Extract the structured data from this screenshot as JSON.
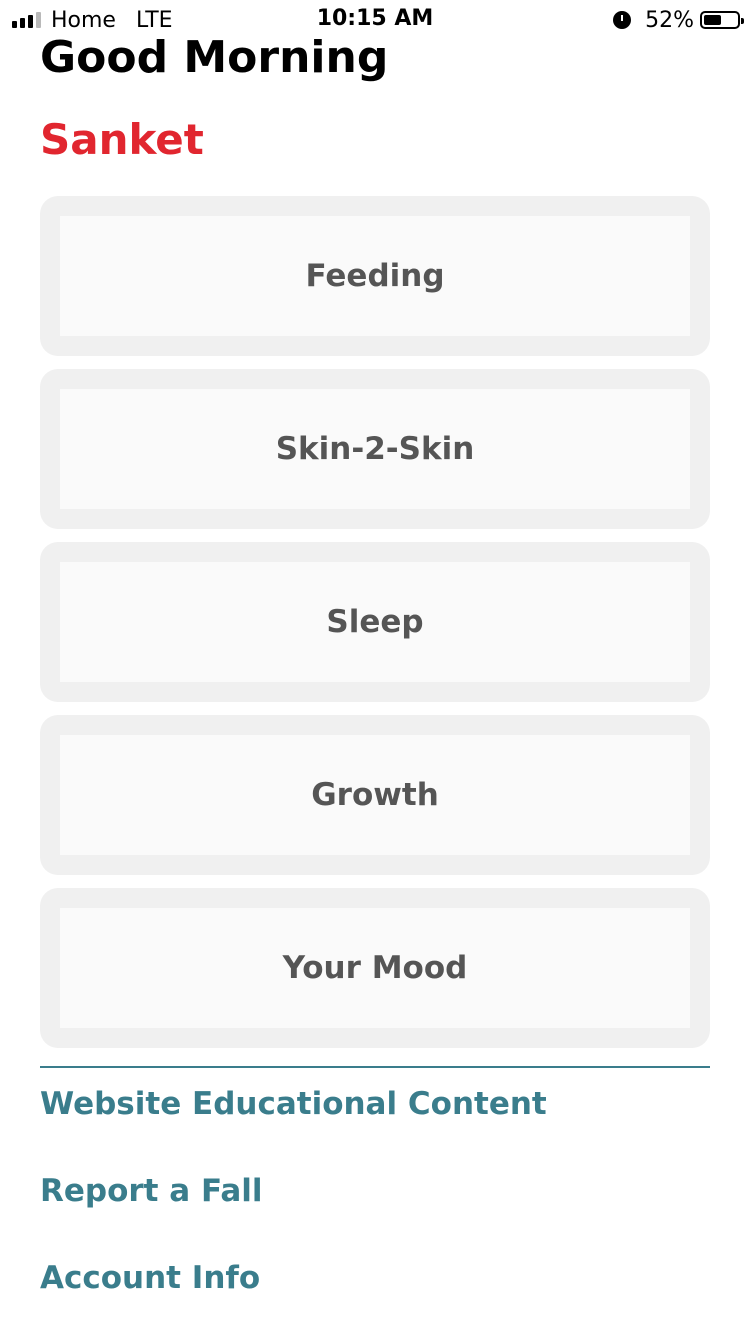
{
  "status_bar": {
    "carrier": "Home",
    "network": "LTE",
    "time": "10:15 AM",
    "battery": "52%",
    "battery_level": 0.52,
    "signal_bars_active": 3,
    "signal_bars_total": 4
  },
  "header": {
    "greeting": "Good Morning",
    "name": "Sanket"
  },
  "cards": [
    {
      "label": "Feeding"
    },
    {
      "label": "Skin-2-Skin"
    },
    {
      "label": "Sleep"
    },
    {
      "label": "Growth"
    },
    {
      "label": "Your Mood"
    }
  ],
  "links": [
    {
      "label": "Website Educational Content"
    },
    {
      "label": "Report a Fall"
    },
    {
      "label": "Account Info"
    }
  ],
  "colors": {
    "name_accent": "#e1262f",
    "link_accent": "#3a7d8c",
    "card_text": "#555555"
  }
}
